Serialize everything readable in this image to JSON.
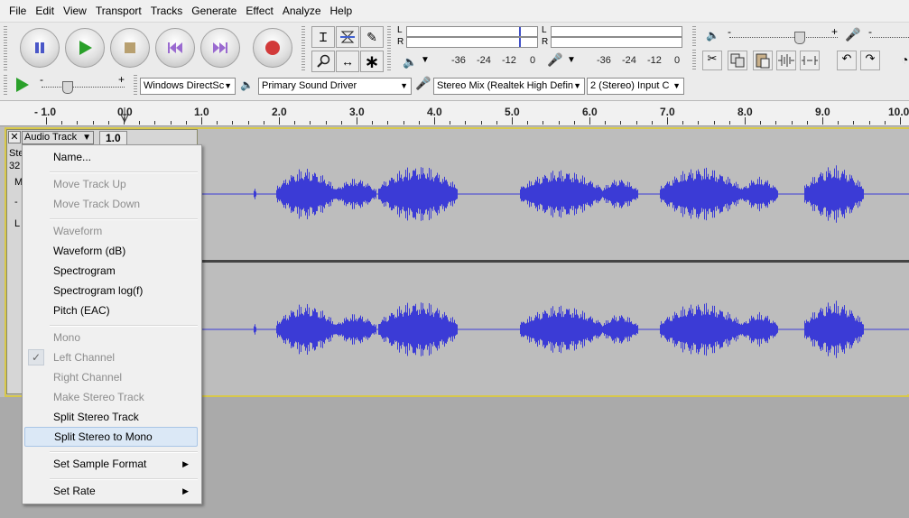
{
  "menubar": [
    "File",
    "Edit",
    "View",
    "Transport",
    "Tracks",
    "Generate",
    "Effect",
    "Analyze",
    "Help"
  ],
  "meter": {
    "play_L": "L",
    "play_R": "R",
    "rec_L": "L",
    "rec_R": "R",
    "play_ticks": [
      "-36",
      "-24",
      "-12",
      "0"
    ],
    "rec_ticks": [
      "-36",
      "-24",
      "-12",
      "0"
    ]
  },
  "devices": {
    "host": "Windows DirectSc",
    "output": "Primary Sound Driver",
    "input": "Stereo Mix (Realtek High Defin",
    "channels": "2 (Stereo) Input C"
  },
  "slider_marks": {
    "minus": "-",
    "plus": "+"
  },
  "ruler": [
    "- 1.0",
    "0.0",
    "1.0",
    "2.0",
    "3.0",
    "4.0",
    "5.0",
    "6.0",
    "7.0",
    "8.0",
    "9.0",
    "10.0"
  ],
  "track": {
    "name": "Audio Track",
    "scale_top": "1.0",
    "info_line1": "Ste",
    "info_line2": "32",
    "btn_mute": "M",
    "mark_1": "-",
    "mark_2": "L"
  },
  "context_menu": {
    "items": [
      {
        "label": "Name...",
        "disabled": false
      },
      {
        "label": "Move Track Up",
        "disabled": true
      },
      {
        "label": "Move Track Down",
        "disabled": true
      },
      {
        "label": "Waveform",
        "disabled": true
      },
      {
        "label": "Waveform (dB)",
        "disabled": false
      },
      {
        "label": "Spectrogram",
        "disabled": false
      },
      {
        "label": "Spectrogram log(f)",
        "disabled": false
      },
      {
        "label": "Pitch (EAC)",
        "disabled": false
      },
      {
        "label": "Mono",
        "disabled": true
      },
      {
        "label": "Left Channel",
        "disabled": true,
        "checked": true
      },
      {
        "label": "Right Channel",
        "disabled": true
      },
      {
        "label": "Make Stereo Track",
        "disabled": true
      },
      {
        "label": "Split Stereo Track",
        "disabled": false
      },
      {
        "label": "Split Stereo to Mono",
        "disabled": false,
        "highlighted": true
      },
      {
        "label": "Set Sample Format",
        "disabled": false,
        "submenu": true
      },
      {
        "label": "Set Rate",
        "disabled": false,
        "submenu": true
      }
    ]
  },
  "colors": {
    "wave": "#3b3bd6",
    "wave_bg": "#bdbdbd",
    "highlight": "#dbe8f6"
  },
  "icons": [
    "pause-icon",
    "play-icon",
    "stop-icon",
    "skip-start-icon",
    "skip-end-icon",
    "record-icon",
    "selection-tool-icon",
    "envelope-tool-icon",
    "draw-tool-icon",
    "zoom-tool-icon",
    "timeshift-tool-icon",
    "multi-tool-icon",
    "speaker-icon",
    "microphone-icon",
    "cut-icon",
    "copy-icon",
    "paste-icon",
    "trim-icon",
    "silence-icon",
    "undo-icon",
    "redo-icon",
    "check-icon",
    "chevron-right-icon"
  ]
}
